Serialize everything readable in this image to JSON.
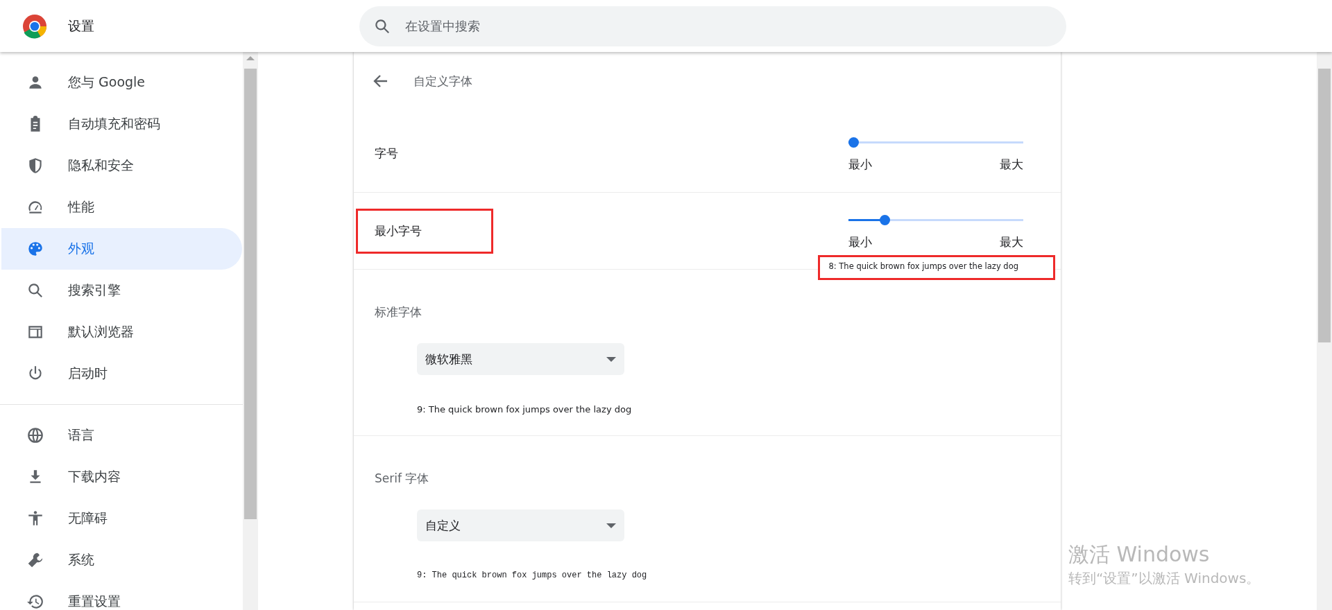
{
  "header": {
    "title": "设置",
    "search": {
      "placeholder": "在设置中搜索"
    }
  },
  "sidebar": {
    "groups": [
      {
        "items": [
          {
            "label": "您与 Google",
            "selected": false
          },
          {
            "label": "自动填充和密码",
            "selected": false
          },
          {
            "label": "隐私和安全",
            "selected": false
          },
          {
            "label": "性能",
            "selected": false
          },
          {
            "label": "外观",
            "selected": true
          },
          {
            "label": "搜索引擎",
            "selected": false
          },
          {
            "label": "默认浏览器",
            "selected": false
          },
          {
            "label": "启动时",
            "selected": false
          }
        ]
      },
      {
        "items": [
          {
            "label": "语言",
            "selected": false
          },
          {
            "label": "下载内容",
            "selected": false
          },
          {
            "label": "无障碍",
            "selected": false
          },
          {
            "label": "系统",
            "selected": false
          },
          {
            "label": "重置设置",
            "selected": false
          }
        ]
      }
    ]
  },
  "page": {
    "title": "自定义字体",
    "sliders": [
      {
        "label": "字号",
        "level": 0,
        "min_label": "最小",
        "max_label": "最大",
        "annotated": false
      },
      {
        "label": "最小字号",
        "level": 0.19,
        "min_label": "最小",
        "max_label": "最大",
        "annotated": true,
        "preview": "8: The quick brown fox jumps over the lazy dog",
        "preview_annotated": true
      }
    ],
    "font_sections": [
      {
        "title": "标准字体",
        "value": "微软雅黑",
        "preview": "9: The quick brown fox jumps over the lazy dog"
      },
      {
        "title": "Serif 字体",
        "value": "自定义",
        "preview": "9: The quick brown fox jumps over the lazy dog"
      }
    ]
  },
  "overlay": {
    "line_1": "激活 Windows",
    "line_2": "转到“设置”以激活 Windows。"
  }
}
